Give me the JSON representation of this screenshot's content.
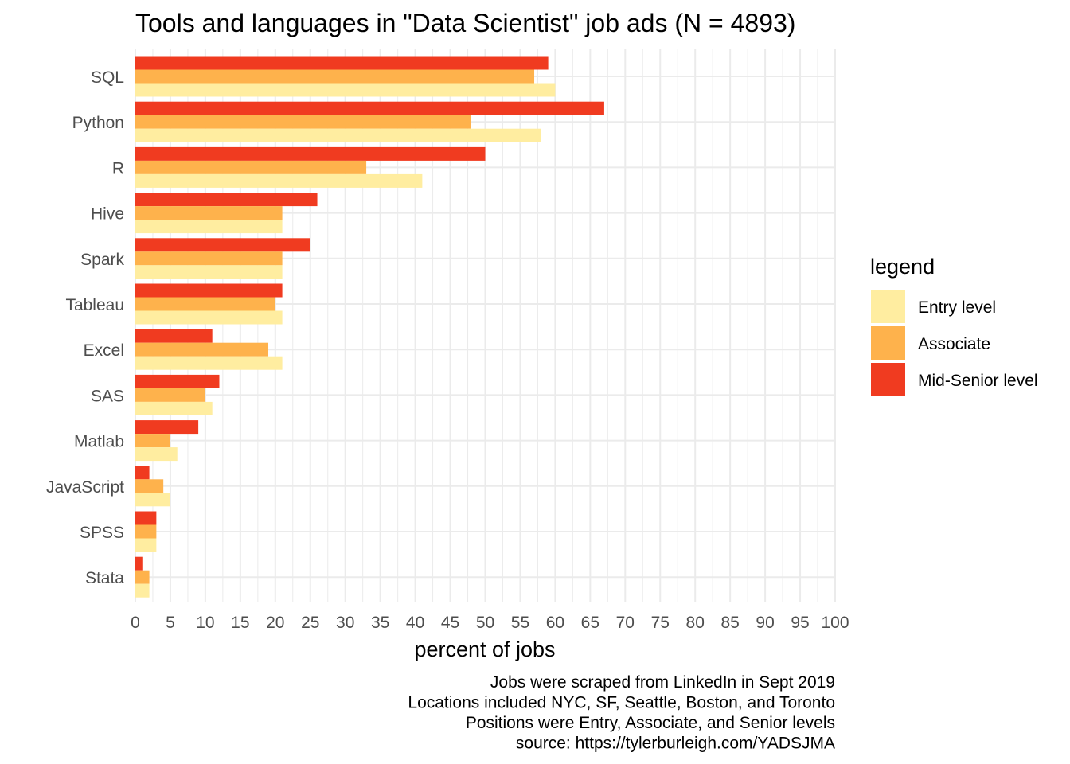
{
  "chart_data": {
    "type": "bar",
    "orientation": "horizontal",
    "title": "Tools and languages in \"Data Scientist\" job ads (N = 4893)",
    "xlabel": "percent of jobs",
    "ylabel": "",
    "xlim": [
      0,
      100
    ],
    "xticks": [
      0,
      5,
      10,
      15,
      20,
      25,
      30,
      35,
      40,
      45,
      50,
      55,
      60,
      65,
      70,
      75,
      80,
      85,
      90,
      95,
      100
    ],
    "grid": true,
    "categories": [
      "SQL",
      "Python",
      "R",
      "Hive",
      "Spark",
      "Tableau",
      "Excel",
      "SAS",
      "Matlab",
      "JavaScript",
      "SPSS",
      "Stata"
    ],
    "series": [
      {
        "name": "Entry level",
        "color": "#FFEDA0",
        "values": [
          60,
          58,
          41,
          21,
          21,
          21,
          21,
          11,
          6,
          5,
          3,
          2
        ]
      },
      {
        "name": "Associate",
        "color": "#FEB24C",
        "values": [
          57,
          48,
          33,
          21,
          21,
          20,
          19,
          10,
          5,
          4,
          3,
          2
        ]
      },
      {
        "name": "Mid-Senior level",
        "color": "#F03B20",
        "values": [
          59,
          67,
          50,
          26,
          25,
          21,
          11,
          12,
          9,
          2,
          3,
          1
        ]
      }
    ],
    "legend": {
      "title": "legend",
      "placement": "right"
    },
    "caption": [
      "Jobs were scraped from LinkedIn in Sept 2019",
      "Locations included NYC, SF, Seattle, Boston, and Toronto",
      "Positions were Entry, Associate, and Senior levels",
      "source: https://tylerburleigh.com/YADSJMA"
    ]
  }
}
